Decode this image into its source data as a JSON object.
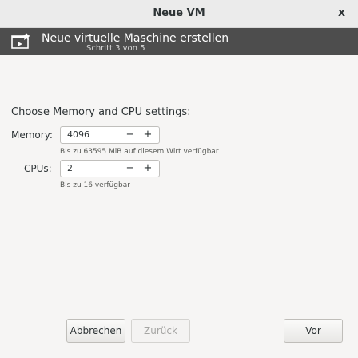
{
  "window": {
    "title": "Neue VM",
    "close_glyph": "x"
  },
  "banner": {
    "icon": "vm-window-icon",
    "heading": "Neue virtuelle Maschine erstellen",
    "step": "Schritt 3 von 5",
    "background_color": "#4d4d4d"
  },
  "intro": "Choose Memory and CPU settings:",
  "memory": {
    "label": "Memory:",
    "value": "4096",
    "decrement": "−",
    "increment": "+",
    "hint": "Bis zu 63595 MiB auf diesem Wirt verfügbar"
  },
  "cpus": {
    "label": "CPUs:",
    "value": "2",
    "decrement": "−",
    "increment": "+",
    "hint": "Bis zu 16 verfügbar"
  },
  "buttons": {
    "cancel": "Abbrechen",
    "back": "Zurück",
    "forward": "Vor"
  }
}
